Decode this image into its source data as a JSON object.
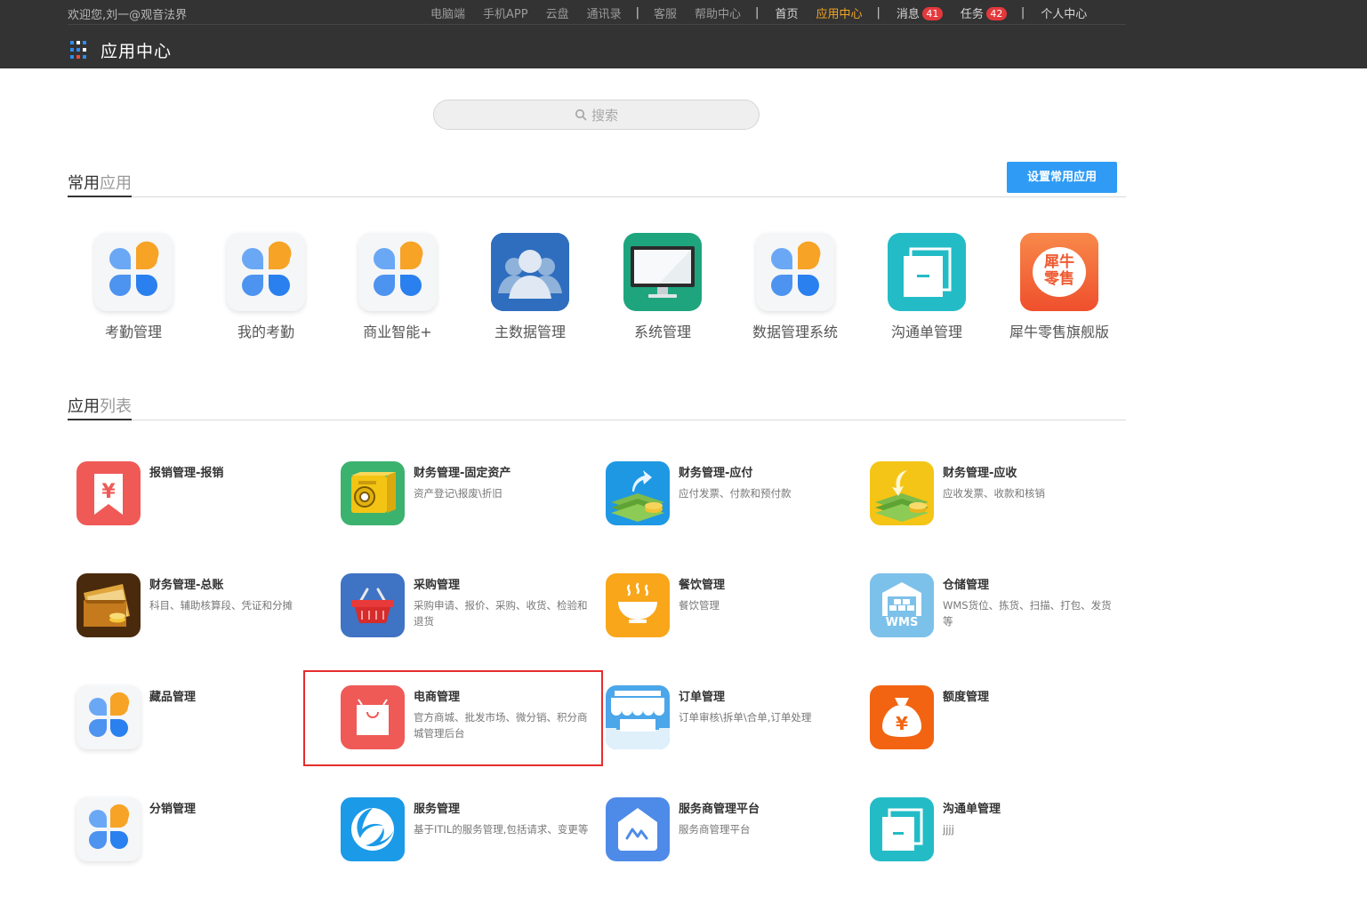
{
  "topbar": {
    "welcome": "欢迎您,刘一@观音法界",
    "nav_group1": [
      "电脑端",
      "手机APP",
      "云盘",
      "通讯录"
    ],
    "nav_group2": [
      "客服",
      "帮助中心"
    ],
    "nav_group3": [
      "首页",
      "应用中心"
    ],
    "messages_label": "消息",
    "messages_count": "41",
    "tasks_label": "任务",
    "tasks_count": "42",
    "personal_center": "个人中心",
    "separator": "|"
  },
  "brand": {
    "title": "应用中心"
  },
  "search": {
    "placeholder": "搜索"
  },
  "favorites_section": {
    "title_a": "常用",
    "title_b": "应用",
    "set_button": "设置常用应用"
  },
  "favorites": [
    {
      "label": "考勤管理",
      "icon": "clover-icon"
    },
    {
      "label": "我的考勤",
      "icon": "clover-icon"
    },
    {
      "label": "商业智能+",
      "icon": "clover-icon"
    },
    {
      "label": "主数据管理",
      "icon": "users-icon"
    },
    {
      "label": "系统管理",
      "icon": "monitor-icon"
    },
    {
      "label": "数据管理系统",
      "icon": "clover-icon"
    },
    {
      "label": "沟通单管理",
      "icon": "docs-icon"
    },
    {
      "label": "犀牛零售旗舰版",
      "icon": "rhino-retail-icon",
      "icon_text_1": "犀牛",
      "icon_text_2": "零售"
    }
  ],
  "apps_section": {
    "title_a": "应用",
    "title_b": "列表"
  },
  "apps": [
    {
      "name": "报销管理-报销",
      "desc": "",
      "icon": "yen-bookmark-icon"
    },
    {
      "name": "财务管理-固定资产",
      "desc": "资产登记\\报废\\折旧",
      "icon": "safe-icon"
    },
    {
      "name": "财务管理-应付",
      "desc": "应付发票、付款和预付款",
      "icon": "money-up-icon"
    },
    {
      "name": "财务管理-应收",
      "desc": "应收发票、收款和核销",
      "icon": "money-down-icon"
    },
    {
      "name": "财务管理-总账",
      "desc": "科目、辅助核算段、凭证和分摊",
      "icon": "wallet-icon"
    },
    {
      "name": "采购管理",
      "desc": "采购申请、报价、采购、收货、检验和退货",
      "icon": "basket-icon"
    },
    {
      "name": "餐饮管理",
      "desc": "餐饮管理",
      "icon": "bowl-icon"
    },
    {
      "name": "仓储管理",
      "desc": "WMS货位、拣货、扫描、打包、发货等",
      "icon": "warehouse-icon",
      "icon_text": "WMS"
    },
    {
      "name": "藏品管理",
      "desc": "",
      "icon": "clover-icon"
    },
    {
      "name": "电商管理",
      "desc": "官方商城、批发市场、微分销、积分商城管理后台",
      "icon": "shopping-bag-icon"
    },
    {
      "name": "订单管理",
      "desc": "订单审核\\拆单\\合单,订单处理",
      "icon": "store-icon"
    },
    {
      "name": "额度管理",
      "desc": "",
      "icon": "money-bag-icon"
    },
    {
      "name": "分销管理",
      "desc": "",
      "icon": "clover-icon"
    },
    {
      "name": "服务管理",
      "desc": "基于ITIL的服务管理,包括请求、变更等",
      "icon": "service-globe-icon"
    },
    {
      "name": "服务商管理平台",
      "desc": "服务商管理平台",
      "icon": "home-chart-icon"
    },
    {
      "name": "沟通单管理",
      "desc": "jjjj",
      "icon": "docs-icon"
    }
  ],
  "colors": {
    "accent": "#2f9bf5",
    "topbar": "#333333",
    "active_nav": "#f5a623",
    "badge": "#e4393c",
    "highlight_box": "#e52d2d"
  }
}
